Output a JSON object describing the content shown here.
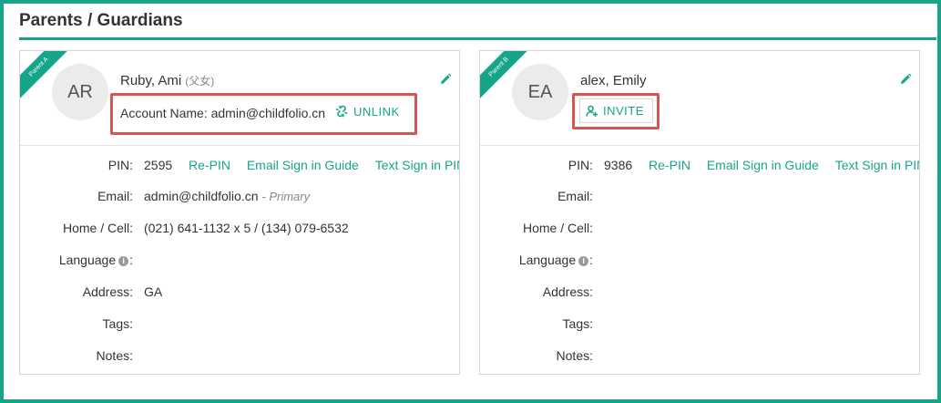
{
  "page": {
    "title": "Parents / Guardians"
  },
  "colors": {
    "accent": "#17a589",
    "highlight_border": "#d9534f"
  },
  "field_labels": {
    "pin": "PIN:",
    "email": "Email:",
    "home_cell": "Home / Cell:",
    "language": "Language",
    "language_colon": ":",
    "address": "Address:",
    "tags": "Tags:",
    "notes": "Notes:"
  },
  "links": {
    "repin": "Re-PIN",
    "email_guide": "Email Sign in Guide",
    "text_pin": "Text Sign in PIN"
  },
  "parents": [
    {
      "ribbon": "Parent A",
      "initials": "AR",
      "name": "Ruby, Ami",
      "relation": "(父女)",
      "account_label": "Account Name: admin@childfolio.cn",
      "account_action": "UNLINK",
      "pin": "2595",
      "email": "admin@childfolio.cn",
      "email_tag": "- Primary",
      "phone": "(021) 641-1132 x 5 / (134) 079-6532",
      "language": "",
      "address": "GA",
      "tags": "",
      "notes": ""
    },
    {
      "ribbon": "Parent B",
      "initials": "EA",
      "name": "alex, Emily",
      "invite": "INVITE",
      "pin": "9386",
      "email": "",
      "phone": "",
      "language": "",
      "address": "",
      "tags": "",
      "notes": ""
    }
  ],
  "icons": {
    "edit": "pencil-icon",
    "unlink": "unlink-icon",
    "invite": "user-invite-icon",
    "info": "info-icon"
  }
}
